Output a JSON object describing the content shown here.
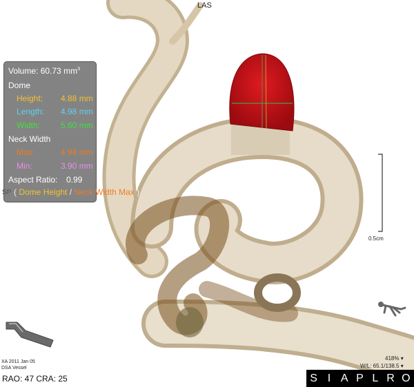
{
  "orientation": {
    "top": "LAS",
    "left": "SP"
  },
  "measurements": {
    "volume_label": "Volume:",
    "volume_value": "60.73 mm",
    "volume_unit_sup": "3",
    "dome_label": "Dome",
    "height_label": "Height:",
    "height_value": "4.88 mm",
    "length_label": "Length:",
    "length_value": "4.98 mm",
    "width_label": "Width:",
    "width_value": "5.60 mm",
    "neck_label": "Neck Width",
    "max_label": "Max:",
    "max_value": "4.94 mm",
    "min_label": "Min:",
    "min_value": "3.90 mm",
    "aspect_label": "Aspect Ratio:",
    "aspect_value": "0.99",
    "note_open": "( ",
    "note_dome_height": "Dome Height",
    "note_sep": " / ",
    "note_neck_width": "Neck Width Max",
    "note_close": " )"
  },
  "scale_bar_label": "0.5cm",
  "study": {
    "line1": "XA 2011 Jan 05",
    "line2": "DSA Vessel"
  },
  "view_angles": "RAO: 47  CRA: 25",
  "zoom": "418%",
  "window_level": "W/L: 65.1/138.5",
  "orientation_buttons": [
    "S",
    "I",
    "A",
    "P",
    "L",
    "R",
    "O"
  ],
  "colors": {
    "aneurysm": "#d4141a",
    "vessel": "#ddd1bd",
    "panel": "#606060"
  }
}
